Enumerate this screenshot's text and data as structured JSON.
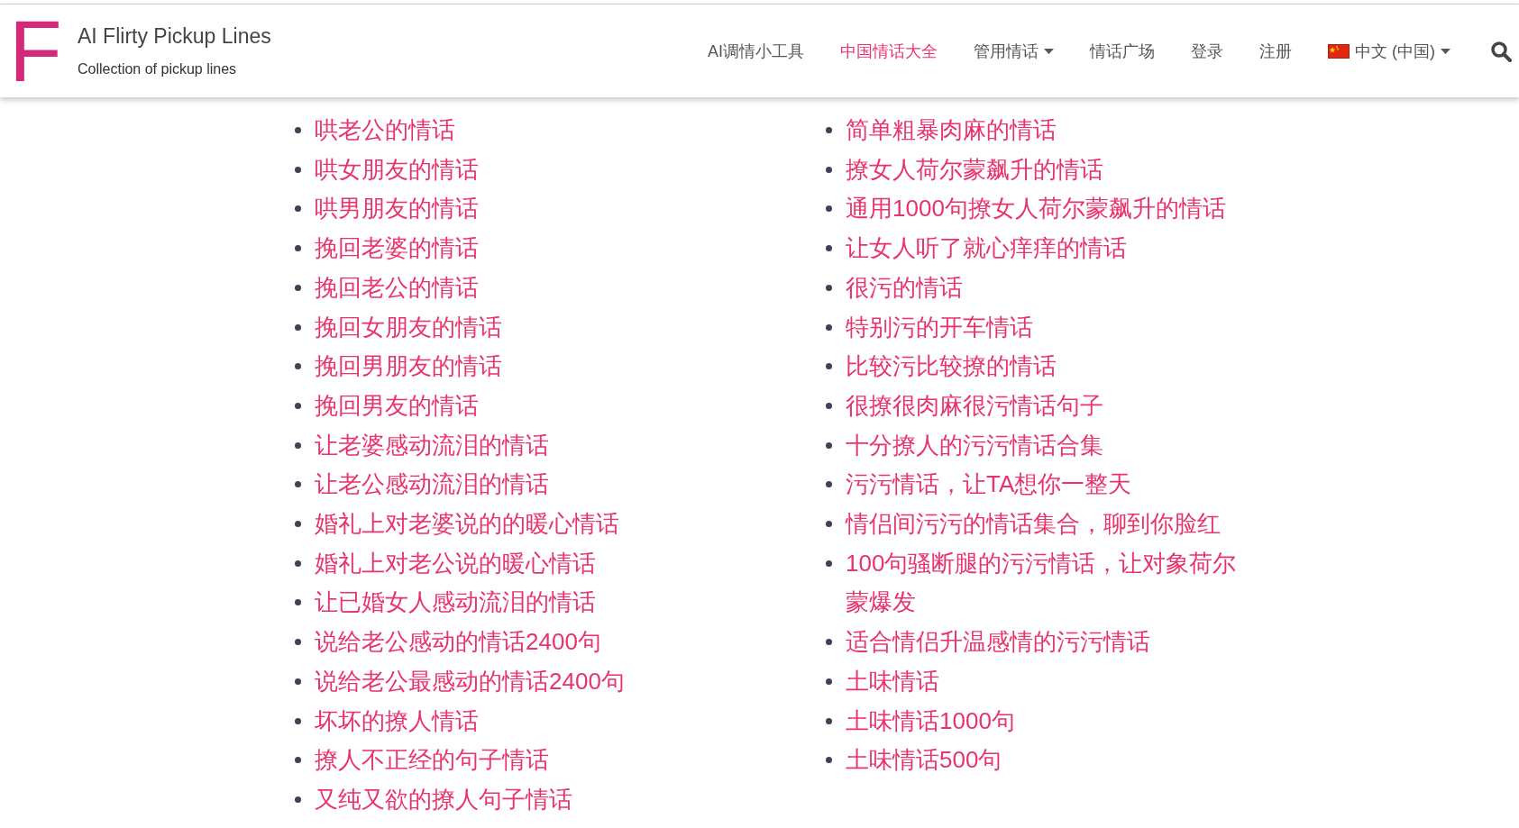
{
  "header": {
    "logo_letter": "F",
    "title": "AI Flirty Pickup Lines",
    "subtitle": "Collection of pickup lines"
  },
  "nav": [
    {
      "label": "AI调情小工具",
      "kind": "link",
      "selected": false
    },
    {
      "label": "中国情话大全",
      "kind": "link",
      "selected": true
    },
    {
      "label": "管用情话",
      "kind": "dropdown",
      "selected": false
    },
    {
      "label": "情话广场",
      "kind": "link",
      "selected": false
    },
    {
      "label": "登录",
      "kind": "link",
      "selected": false
    },
    {
      "label": "注册",
      "kind": "link",
      "selected": false
    },
    {
      "label": "中文 (中国)",
      "kind": "language",
      "selected": false
    }
  ],
  "columns": [
    [
      "哄老公的情话",
      "哄女朋友的情话",
      "哄男朋友的情话",
      "挽回老婆的情话",
      "挽回老公的情话",
      "挽回女朋友的情话",
      "挽回男朋友的情话",
      "挽回男友的情话",
      "让老婆感动流泪的情话",
      "让老公感动流泪的情话",
      "婚礼上对老婆说的的暖心情话",
      "婚礼上对老公说的暖心情话",
      "让已婚女人感动流泪的情话",
      "说给老公感动的情话2400句",
      "说给老公最感动的情话2400句",
      "坏坏的撩人情话",
      "撩人不正经的句子情话",
      "又纯又欲的撩人句子情话"
    ],
    [
      "简单粗暴肉麻的情话",
      "撩女人荷尔蒙飙升的情话",
      "通用1000句撩女人荷尔蒙飙升的情话",
      "让女人听了就心痒痒的情话",
      "很污的情话",
      "特别污的开车情话",
      "比较污比较撩的情话",
      "很撩很肉麻很污情话句子",
      "十分撩人的污污情话合集",
      "污污情话，让TA想你一整天",
      "情侣间污污的情话集合，聊到你脸红",
      "100句骚断腿的污污情话，让对象荷尔蒙爆发",
      "适合情侣升温感情的污污情话",
      "土味情话",
      "土味情话1000句",
      "土味情话500句"
    ]
  ]
}
